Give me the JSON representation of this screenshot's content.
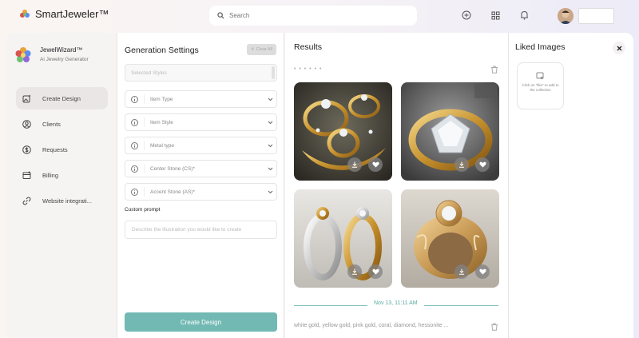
{
  "app": {
    "brand_name": "SmartJeweler™"
  },
  "search": {
    "placeholder": "Search"
  },
  "sidebar": {
    "app_name": "JewelWizard™",
    "app_subtitle": "Ai Jewelry Generator",
    "items": [
      {
        "label": "Create Design",
        "icon": "sparkle-image-icon",
        "active": true
      },
      {
        "label": "Clients",
        "icon": "user-circle-icon"
      },
      {
        "label": "Requests",
        "icon": "dollar-circle-icon"
      },
      {
        "label": "Billing",
        "icon": "billing-icon"
      },
      {
        "label": "Website integrati...",
        "icon": "link-icon"
      }
    ]
  },
  "settings": {
    "title": "Generation Settings",
    "clear_all": "Clear All",
    "saved_styles_placeholder": "Selected Styles",
    "dropdowns": [
      {
        "label": "Item Type"
      },
      {
        "label": "Item Style"
      },
      {
        "label": "Metal type"
      },
      {
        "label": "Center Stone (CS)*"
      },
      {
        "label": "Accent Stone (AS)*"
      }
    ],
    "custom_prompt_label": "Custom prompt",
    "custom_prompt_placeholder": "Describe the illustration you would like to create",
    "create_button": "Create Design"
  },
  "results": {
    "title": "Results",
    "loading_dots": "• • • • • •",
    "date": "Nov 13, 11:11 AM",
    "tags": "white gold, yellow gold, pink gold, coral, diamond, hessonite ..."
  },
  "liked": {
    "title": "Liked Images",
    "empty_message": "Click on \"like\" to add to the collection"
  },
  "colors": {
    "accent": "#72b9b3",
    "divider": "#7fbfba"
  }
}
